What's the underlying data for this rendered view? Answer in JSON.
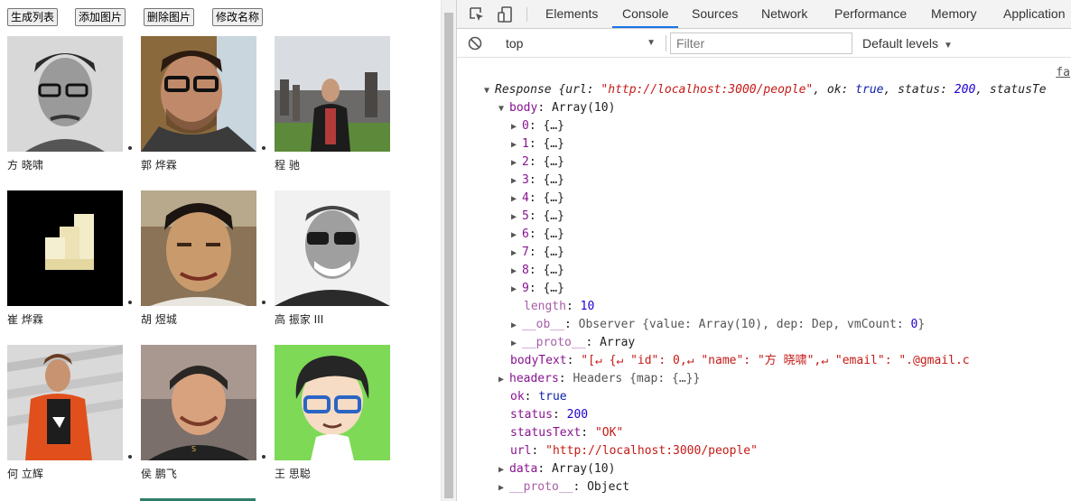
{
  "page": {
    "buttons": [
      {
        "label": "生成列表"
      },
      {
        "label": "添加图片"
      },
      {
        "label": "删除图片"
      },
      {
        "label": "修改名称"
      }
    ],
    "people": [
      {
        "name": "方 晓啸",
        "photo": "portrait-glasses-bw"
      },
      {
        "name": "郭 烨霖",
        "photo": "portrait-selfie"
      },
      {
        "name": "程 驰",
        "photo": "portrait-outdoor"
      },
      {
        "name": "崔 烨霖",
        "photo": "pixel-logo"
      },
      {
        "name": "胡 煜城",
        "photo": "portrait-smiling"
      },
      {
        "name": "高 振家 III",
        "photo": "portrait-glasses-bw"
      },
      {
        "name": "何 立辉",
        "photo": "portrait-stairs"
      },
      {
        "name": "侯 鹏飞",
        "photo": "portrait-beanie"
      },
      {
        "name": "王 思聪",
        "photo": "cartoon-avatar"
      }
    ]
  },
  "devtools": {
    "tabs": [
      "Elements",
      "Console",
      "Sources",
      "Network",
      "Performance",
      "Memory",
      "Application"
    ],
    "active_tab": "Console",
    "context": "top",
    "filter_placeholder": "Filter",
    "levels": "Default levels",
    "source_link": "fa",
    "console": {
      "response_label": "Response",
      "response_summary_prefix": "{url: ",
      "response_url": "\"http://localhost:3000/people\"",
      "response_ok_key": ", ok: ",
      "response_ok_val": "true",
      "response_status_key": ", status: ",
      "response_status_val": "200",
      "response_tail": ", statusTe",
      "body_key": "body",
      "body_val": "Array(10)",
      "items": [
        "0",
        "1",
        "2",
        "3",
        "4",
        "5",
        "6",
        "7",
        "8",
        "9"
      ],
      "item_preview": "{…}",
      "length_key": "length",
      "length_val": "10",
      "ob_key": "__ob__",
      "ob_val": "Observer {value: Array(10), dep: Dep, vmCount: ",
      "ob_count": "0",
      "ob_close": "}",
      "proto_key": "__proto__",
      "proto_array": "Array",
      "bodytext_key": "bodyText",
      "bodytext_val": "\"[↵  {↵    \"id\": 0,↵    \"name\": \"方 晓啸\",↵    \"email\": \".@gmail.c",
      "headers_key": "headers",
      "headers_val": "Headers {map: {…}}",
      "ok_key": "ok",
      "ok_val": "true",
      "status_key": "status",
      "status_val": "200",
      "statustext_key": "statusText",
      "statustext_val": "\"OK\"",
      "url_key": "url",
      "url_val": "\"http://localhost:3000/people\"",
      "data_key": "data",
      "data_val": "Array(10)",
      "proto_obj_key": "__proto__",
      "proto_obj_val": "Object"
    }
  }
}
